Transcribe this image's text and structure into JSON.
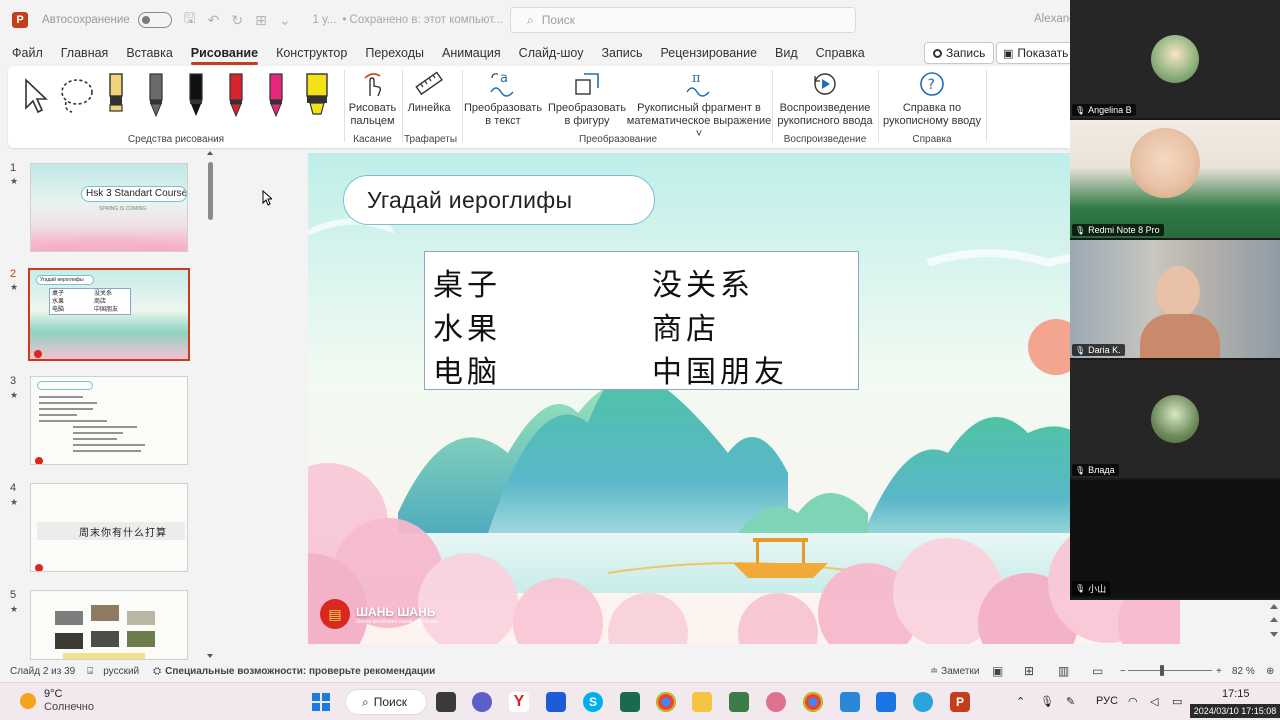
{
  "titlebar": {
    "app_icon": "P",
    "autosave_label": "Автосохранение",
    "doc_name": "1 у...",
    "saved_status": "• Сохранено в: этот компьют...",
    "search_placeholder": "Поиск",
    "user": "Alexand"
  },
  "menu": {
    "items": [
      "Файл",
      "Главная",
      "Вставка",
      "Рисование",
      "Конструктор",
      "Переходы",
      "Анимация",
      "Слайд-шоу",
      "Запись",
      "Рецензирование",
      "Вид",
      "Справка"
    ],
    "active": "Рисование",
    "record_label": "Запись",
    "show_label": "Показать в"
  },
  "ribbon": {
    "groups": {
      "drawing_tools": "Средства рисования",
      "touch": "Касание",
      "stencils": "Трафареты",
      "convert": "Преобразование",
      "replay": "Воспроизведение",
      "help": "Справка"
    },
    "buttons": {
      "finger_line1": "Рисовать",
      "finger_line2": "пальцем",
      "ruler": "Линейка",
      "to_text_line1": "Преобразовать",
      "to_text_line2": "в текст",
      "to_shape_line1": "Преобразовать",
      "to_shape_line2": "в фигуру",
      "math_line1": "Рукописный фрагмент в",
      "math_line2": "математическое выражение ˅",
      "replay_line1": "Воспроизведение",
      "replay_line2": "рукописного ввода",
      "help_line1": "Справка по",
      "help_line2": "рукописному вводу"
    },
    "pen_colors": [
      "#f3d27a",
      "#6b6b6b",
      "#111111",
      "#d9232d",
      "#e6277b",
      "#f3e21a"
    ]
  },
  "thumbnails": {
    "slides": [
      {
        "num": "1",
        "title": "Hsk 3 Standart Course",
        "subtitle": "SPRING IS COMING"
      },
      {
        "num": "2",
        "title": "Угадай иероглифы",
        "cells": [
          "桌子",
          "没关系",
          "水果",
          "商店",
          "电脑",
          "中国朋友"
        ]
      },
      {
        "num": "3"
      },
      {
        "num": "4",
        "title": "周末你有什么打算"
      },
      {
        "num": "5"
      }
    ],
    "active_index": 1
  },
  "slide": {
    "title": "Угадай иероглифы",
    "words": [
      [
        "桌子",
        "没关系"
      ],
      [
        "水果",
        "商店"
      ],
      [
        "电脑",
        "中国朋友"
      ]
    ],
    "logo": "ШАНЬ ШАНЬ",
    "logo_sub": "Школа китайского языка и культуры"
  },
  "statusbar": {
    "slide_info": "Слайд 2 из 39",
    "language": "русский",
    "accessibility": "Специальные возможности: проверьте рекомендации",
    "notes": "Заметки",
    "zoom": "82 %"
  },
  "participants": [
    {
      "name": "Angelina B",
      "kind": "avatar",
      "color": "#8ab07a"
    },
    {
      "name": "Redmi Note 8 Pro",
      "kind": "video",
      "color": "#2f7a45"
    },
    {
      "name": "Daria K.",
      "kind": "video",
      "color": "#8b9aa6"
    },
    {
      "name": "Влада",
      "kind": "avatar",
      "color": "#6d8a5a"
    },
    {
      "name": "小山",
      "kind": "empty",
      "color": "#111111"
    }
  ],
  "taskbar": {
    "weather_temp": "9°C",
    "weather_desc": "Солнечно",
    "search_label": "Поиск",
    "lang": "РУС",
    "time": "17:15",
    "timestamp": "2024/03/10 17:15:08"
  }
}
